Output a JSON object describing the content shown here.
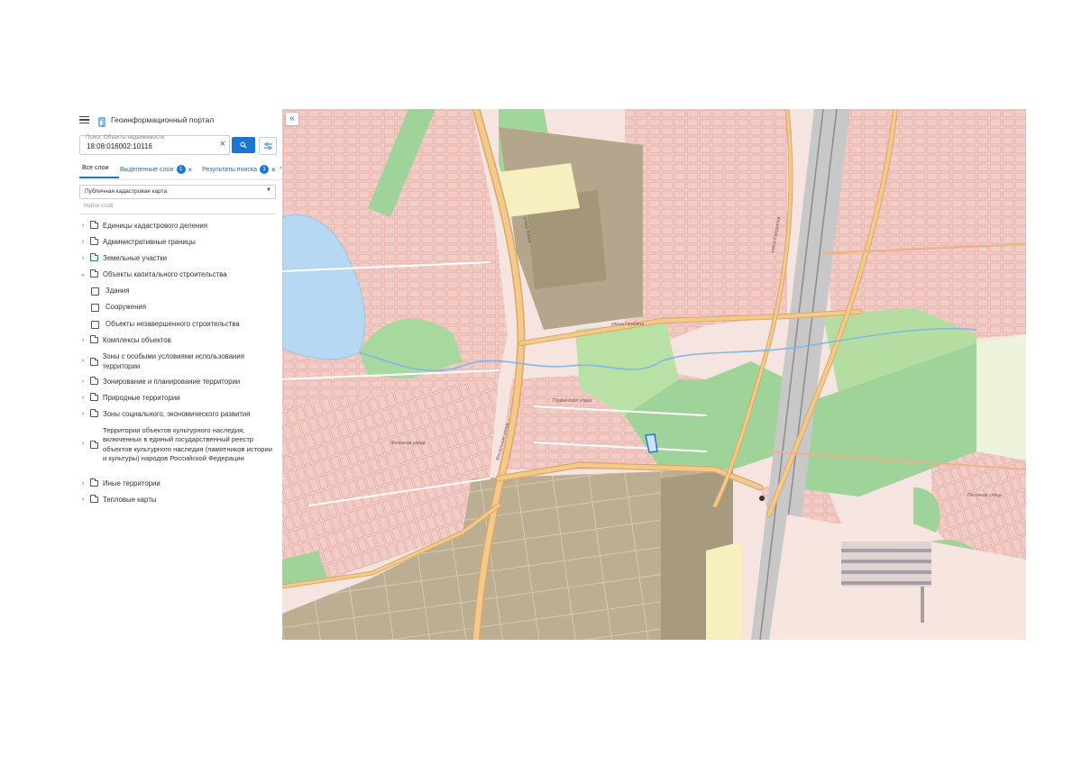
{
  "header": {
    "title": "Геоинформационный портал"
  },
  "search": {
    "label": "Поиск: Объекты недвижимости",
    "value": "18:08:016002:10116"
  },
  "tabs": [
    {
      "label": "Все слои"
    },
    {
      "label": "Выделенные слои",
      "badge": "1"
    },
    {
      "label": "Результаты поиска",
      "badge": "1"
    }
  ],
  "basemap_select": {
    "value": "Публичная кадастровая карта"
  },
  "layer_search": {
    "placeholder": "Найти слой"
  },
  "layers": [
    {
      "label": "Единицы кадастрового деления",
      "kind": "folder",
      "expanded": false
    },
    {
      "label": "Административные границы",
      "kind": "folder",
      "expanded": false
    },
    {
      "label": "Земельные участки",
      "kind": "folder",
      "expanded": false,
      "active": true
    },
    {
      "label": "Объекты капитального строительства",
      "kind": "folder",
      "expanded": true
    },
    {
      "label": "Здания",
      "kind": "checkbox"
    },
    {
      "label": "Сооружения",
      "kind": "checkbox"
    },
    {
      "label": "Объекты незавершенного строительства",
      "kind": "checkbox"
    },
    {
      "label": "Комплексы объектов",
      "kind": "folder",
      "expanded": false
    },
    {
      "label": "Зоны с особыми условиями использования территории",
      "kind": "folder",
      "expanded": false
    },
    {
      "label": "Зонирование и планирование территории",
      "kind": "folder",
      "expanded": false
    },
    {
      "label": "Природные территории",
      "kind": "folder",
      "expanded": false
    },
    {
      "label": "Зоны социального, экономического развития",
      "kind": "folder",
      "expanded": false
    },
    {
      "label": "Территории объектов культурного наследия, включенных в единый государственный реестр объектов культурного наследия (памятников истории и культуры) народов Российской Федерации",
      "kind": "folder",
      "expanded": false
    },
    {
      "label": "Иные территории",
      "kind": "folder",
      "expanded": false
    },
    {
      "label": "Тепловые карты",
      "kind": "folder",
      "expanded": false
    }
  ],
  "map": {
    "colors": {
      "urban": "#f6e4e0",
      "parcel_fill": "#f2cfc9",
      "parcel_edge": "#e58a80",
      "road": "#f4c98c",
      "road_edge": "#dba866",
      "industrial": "#b6a88e",
      "industrial_dark": "#9e9278",
      "green": "#9fd39a",
      "park": "#b9e0a5",
      "water": "#b6d8f2",
      "rail": "#a9a9a9",
      "highlight": "#2a74d6"
    },
    "street_labels": [
      "улица Гагарина",
      "улица Азина",
      "улица Свердлова",
      "Железная улица",
      "Вокзальная улица",
      "Пушкинская улица",
      "Песочная улица"
    ]
  }
}
